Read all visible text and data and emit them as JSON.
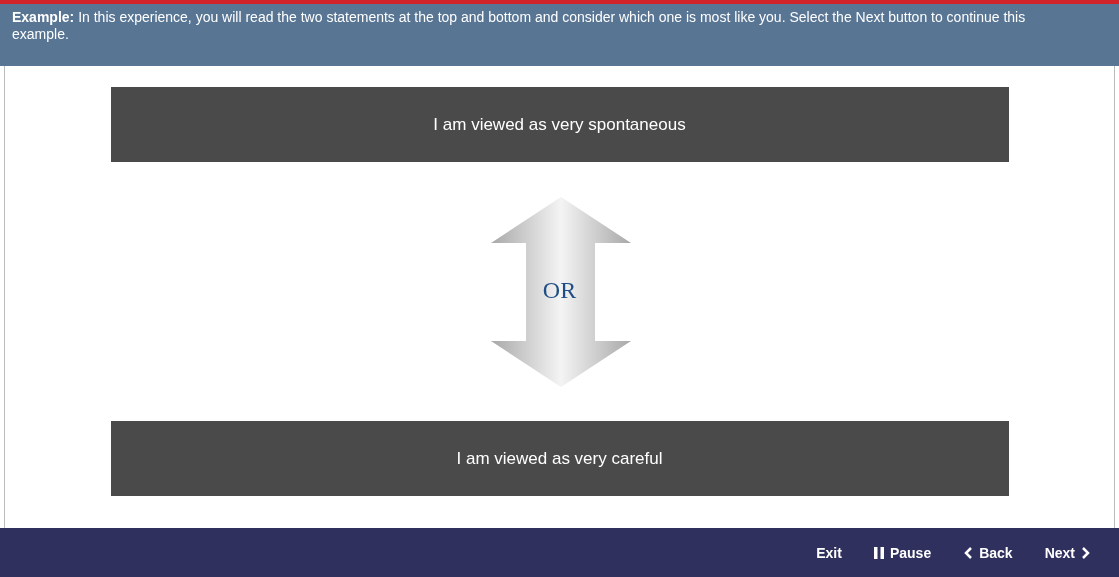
{
  "instructions": "**Example:** In this experience, you will read the two statements at the top and bottom and consider which one is most like you. Select the Next button to continue this example.",
  "statements": [
    {
      "text": "I am viewed as very spontaneous"
    },
    {
      "text": "I am viewed as very careful"
    }
  ],
  "divider_label": "OR",
  "buttons": [
    {
      "label": "Exit",
      "kind": "exit"
    },
    {
      "label": "Pause",
      "kind": "pause"
    },
    {
      "label": "Back",
      "kind": "back"
    },
    {
      "label": "Next",
      "kind": "next"
    }
  ]
}
